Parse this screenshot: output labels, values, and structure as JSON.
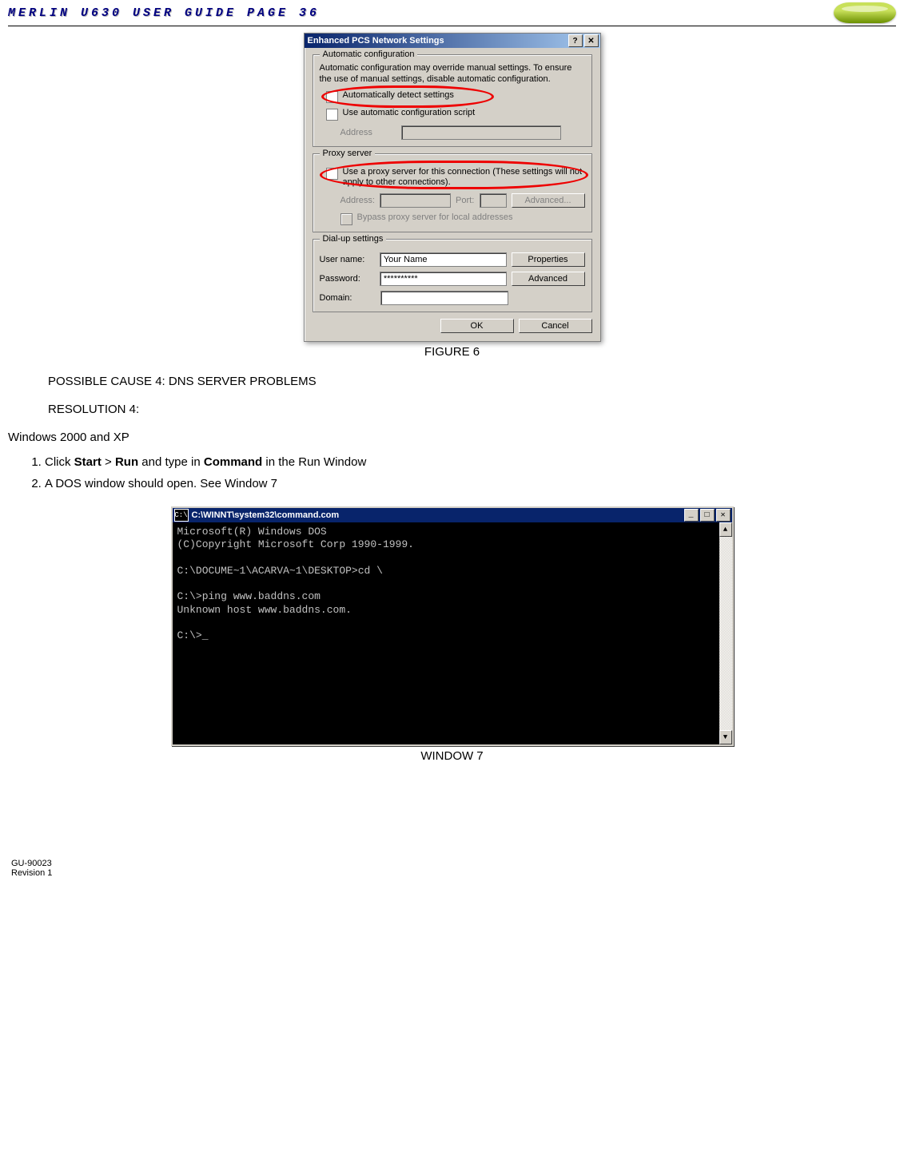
{
  "header": {
    "title": "MERLIN U630 USER GUIDE PAGE 36"
  },
  "dialog": {
    "title": "Enhanced PCS Network Settings",
    "auto": {
      "group": "Automatic configuration",
      "desc": "Automatic configuration may override manual settings.  To ensure the use of manual settings, disable automatic configuration.",
      "chk1": "Automatically detect settings",
      "chk2": "Use automatic configuration script",
      "addressLabel": "Address"
    },
    "proxy": {
      "group": "Proxy server",
      "chk": "Use a proxy server for this connection (These settings will not apply to other connections).",
      "addressLabel": "Address:",
      "portLabel": "Port:",
      "advanced": "Advanced...",
      "bypass": "Bypass proxy server for local addresses"
    },
    "dial": {
      "group": "Dial-up settings",
      "userLabel": "User name:",
      "userValue": "Your Name",
      "passLabel": "Password:",
      "passValue": "**********",
      "domainLabel": "Domain:",
      "properties": "Properties",
      "advanced": "Advanced"
    },
    "buttons": {
      "ok": "OK",
      "cancel": "Cancel",
      "help": "?",
      "close": "✕"
    }
  },
  "figureCaption": "FIGURE 6",
  "cause": "POSSIBLE CAUSE 4:  DNS SERVER PROBLEMS",
  "resolution": "RESOLUTION 4:",
  "winHeader": "Windows 2000 and XP",
  "steps": {
    "s1a": "Click ",
    "s1b": "Start",
    "s1c": " > ",
    "s1d": "Run",
    "s1e": " and type in ",
    "s1f": "Command",
    "s1g": " in the Run Window",
    "s2": "A DOS window should open.  See Window 7"
  },
  "dos": {
    "titleIcon": "C:\\",
    "title": "C:\\WINNT\\system32\\command.com",
    "body": "Microsoft(R) Windows DOS\n(C)Copyright Microsoft Corp 1990-1999.\n\nC:\\DOCUME~1\\ACARVA~1\\DESKTOP>cd \\\n\nC:\\>ping www.baddns.com\nUnknown host www.baddns.com.\n\nC:\\>",
    "min": "_",
    "max": "□",
    "close": "✕",
    "up": "▲",
    "down": "▼"
  },
  "windowCaption": "WINDOW 7",
  "footer": {
    "doc": "GU-90023",
    "rev": "Revision 1"
  }
}
